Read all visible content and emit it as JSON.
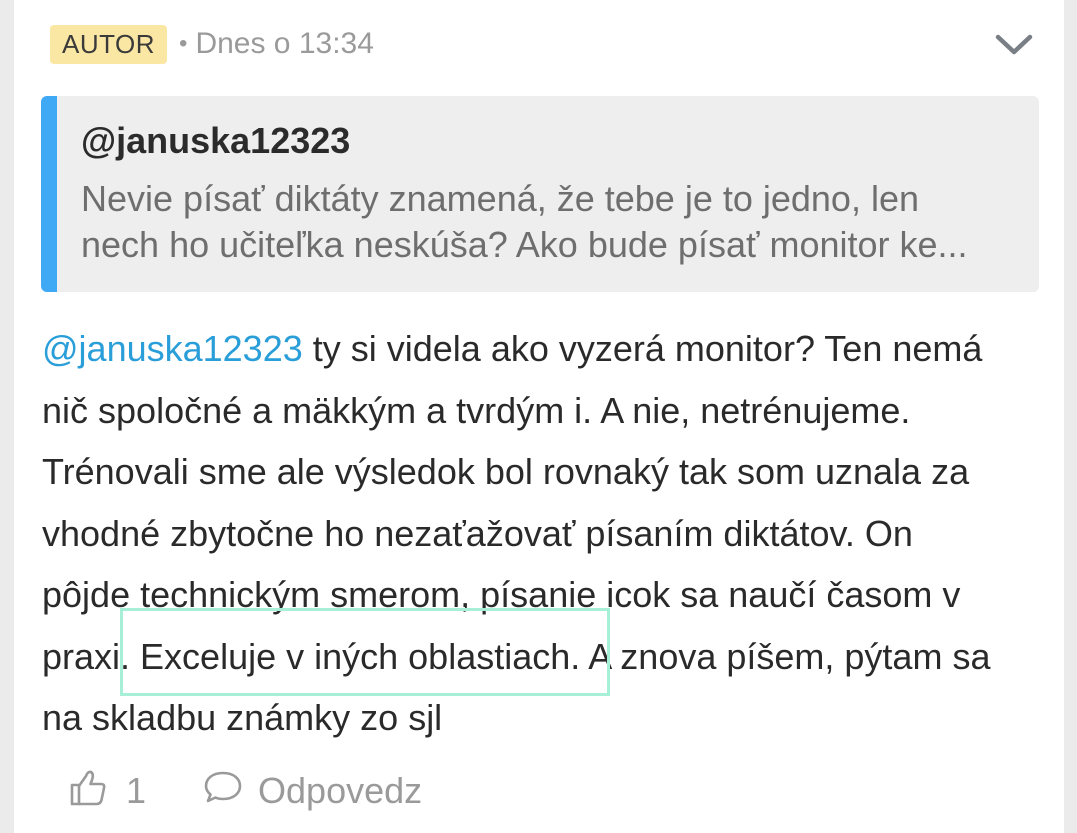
{
  "header": {
    "badge": "AUTOR",
    "separator": "•",
    "timestamp": "Dnes o 13:34"
  },
  "quote": {
    "author": "@januska12323",
    "lines": [
      "Nevie písať diktáty znamená, že tebe je to jedno, len",
      "nech ho učiteľka neskúša? Ako bude písať monitor ke..."
    ]
  },
  "comment": {
    "mention": "@januska12323",
    "line1_rest": " ty si videla ako vyzerá monitor? Ten nemá",
    "line2": "nič spoločné a mäkkým a tvrdým i. A nie, netrénujeme.",
    "line3": "Trénovali sme ale výsledok bol rovnaký tak som uznala za",
    "line4": "vhodné zbytočne ho nezaťažovať písaním diktátov. On",
    "line5": "pôjde technickým smerom, písanie icok sa naučí časom v",
    "line6_pre": "prax",
    "line6_highlight": "i. Exceluje v iných oblastiach.",
    "line6_post": " A znova píšem, pýtam sa",
    "line7": "na skladbu známky zo sjl"
  },
  "actions": {
    "like_count": "1",
    "reply_label": "Odpovedz"
  },
  "colors": {
    "badge_bg": "#fbe7a4",
    "accent": "#3fa9f5",
    "mention": "#2a9ed8",
    "highlight_border": "#a7efd7"
  }
}
